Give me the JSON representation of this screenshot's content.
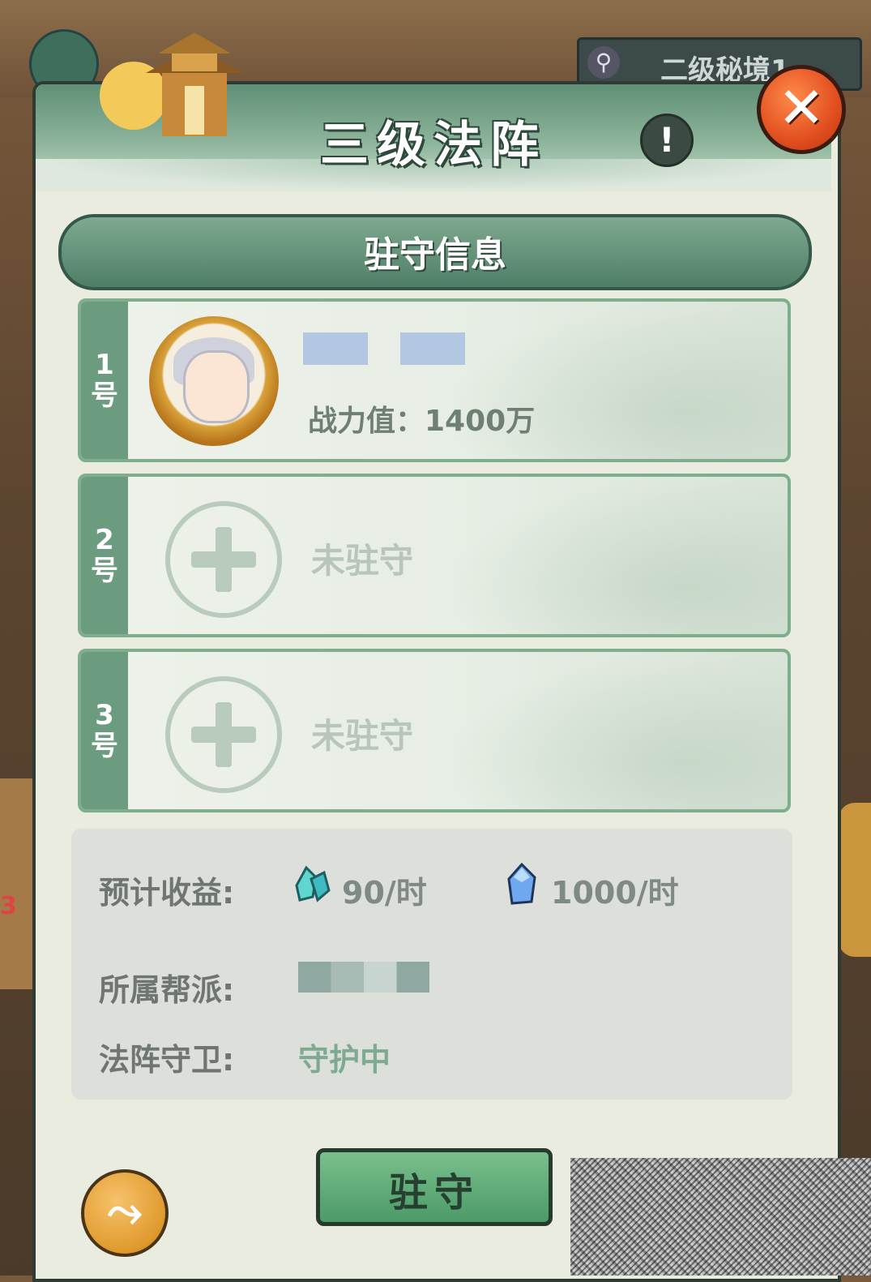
{
  "background": {
    "search_text": "二级秘境1",
    "side_number": "3"
  },
  "dialog": {
    "title": "三级法阵",
    "info_icon": "info-icon",
    "close_icon": "close-icon"
  },
  "section": {
    "title": "驻守信息"
  },
  "slots": [
    {
      "number": "1",
      "suffix": "号",
      "occupied": true,
      "power_label": "战力值：1400万"
    },
    {
      "number": "2",
      "suffix": "号",
      "occupied": false,
      "status": "未驻守"
    },
    {
      "number": "3",
      "suffix": "号",
      "occupied": false,
      "status": "未驻守"
    }
  ],
  "info": {
    "income_label": "预计收益:",
    "income_crystal": "90/时",
    "income_gem": "1000/时",
    "guild_label": "所属帮派:",
    "guard_label": "法阵守卫:",
    "guard_value": "守护中"
  },
  "actions": {
    "station_label": "驻守",
    "share_icon": "share-icon"
  },
  "colors": {
    "header_green": "#5f8f76",
    "button_green": "#4c9a67",
    "close_red": "#e24f1f",
    "share_orange": "#e09a2e"
  }
}
